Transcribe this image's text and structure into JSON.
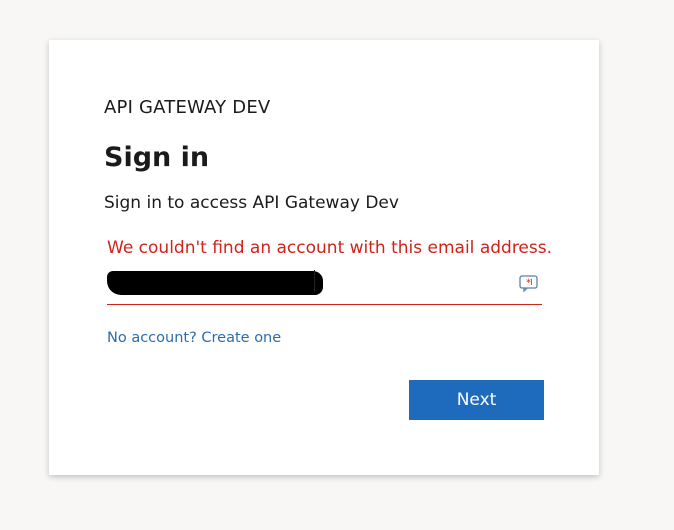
{
  "card": {
    "brand": "API GATEWAY DEV",
    "title": "Sign in",
    "subtitle": "Sign in to access API Gateway Dev",
    "error_message": "We couldn't find an account with this email address.",
    "email": {
      "value": "",
      "redacted": true
    },
    "create_account_link": "No account? Create one",
    "next_button": "Next"
  },
  "colors": {
    "error": "#d0231a",
    "accent": "#1e6bbd",
    "link": "#2b6cb0"
  },
  "icons": {
    "input_trailing": "password-manager-autofill-icon"
  }
}
